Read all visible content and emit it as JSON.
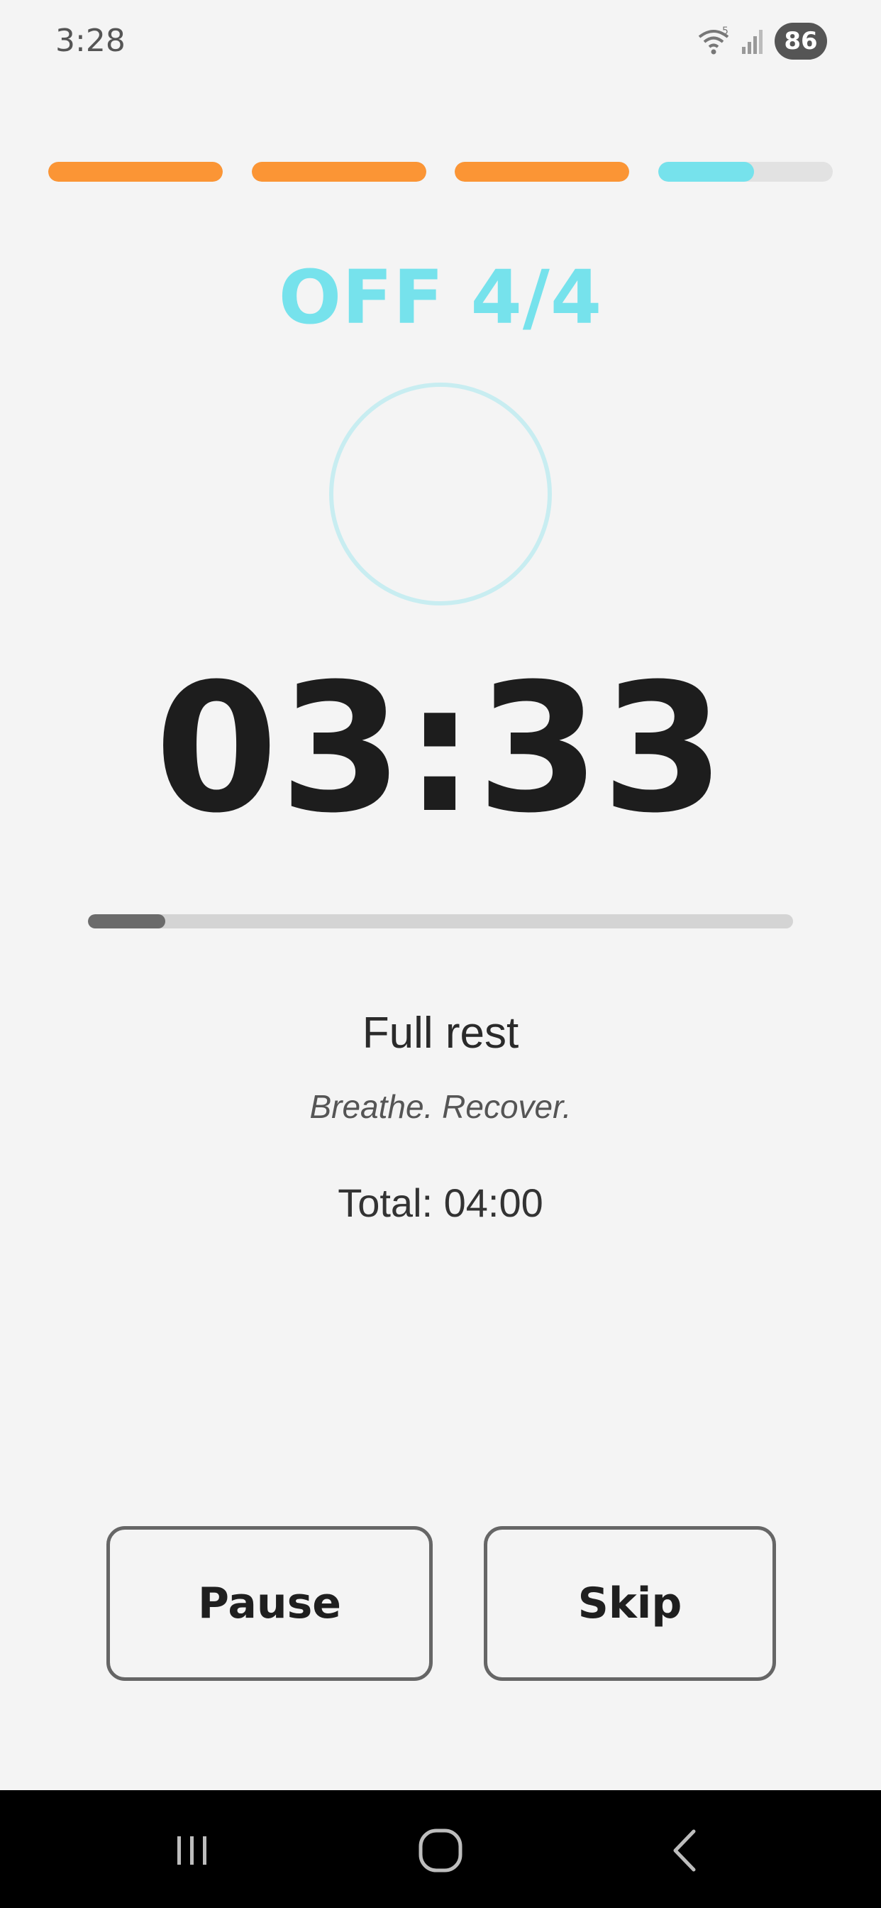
{
  "status_bar": {
    "time": "3:28",
    "battery": "86",
    "wifi_icon": "wifi-icon",
    "signal_icon": "signal-icon"
  },
  "intervals": {
    "segments": [
      {
        "state": "done",
        "color": "#fb9535",
        "progress": 1.0
      },
      {
        "state": "done",
        "color": "#fb9535",
        "progress": 1.0
      },
      {
        "state": "done",
        "color": "#fb9535",
        "progress": 1.0
      },
      {
        "state": "current",
        "color": "#76e2ec",
        "progress": 0.55
      }
    ]
  },
  "phase": {
    "label": "OFF 4/4",
    "color": "#76e2ec"
  },
  "timer": {
    "remaining": "03:33",
    "progress": 0.11
  },
  "step": {
    "name": "Full rest",
    "hint": "Breathe. Recover.",
    "total": "Total: 04:00"
  },
  "controls": {
    "pause_label": "Pause",
    "skip_label": "Skip"
  },
  "navigation": {
    "recent_icon": "recent-apps-icon",
    "home_icon": "home-icon",
    "back_icon": "back-icon"
  }
}
